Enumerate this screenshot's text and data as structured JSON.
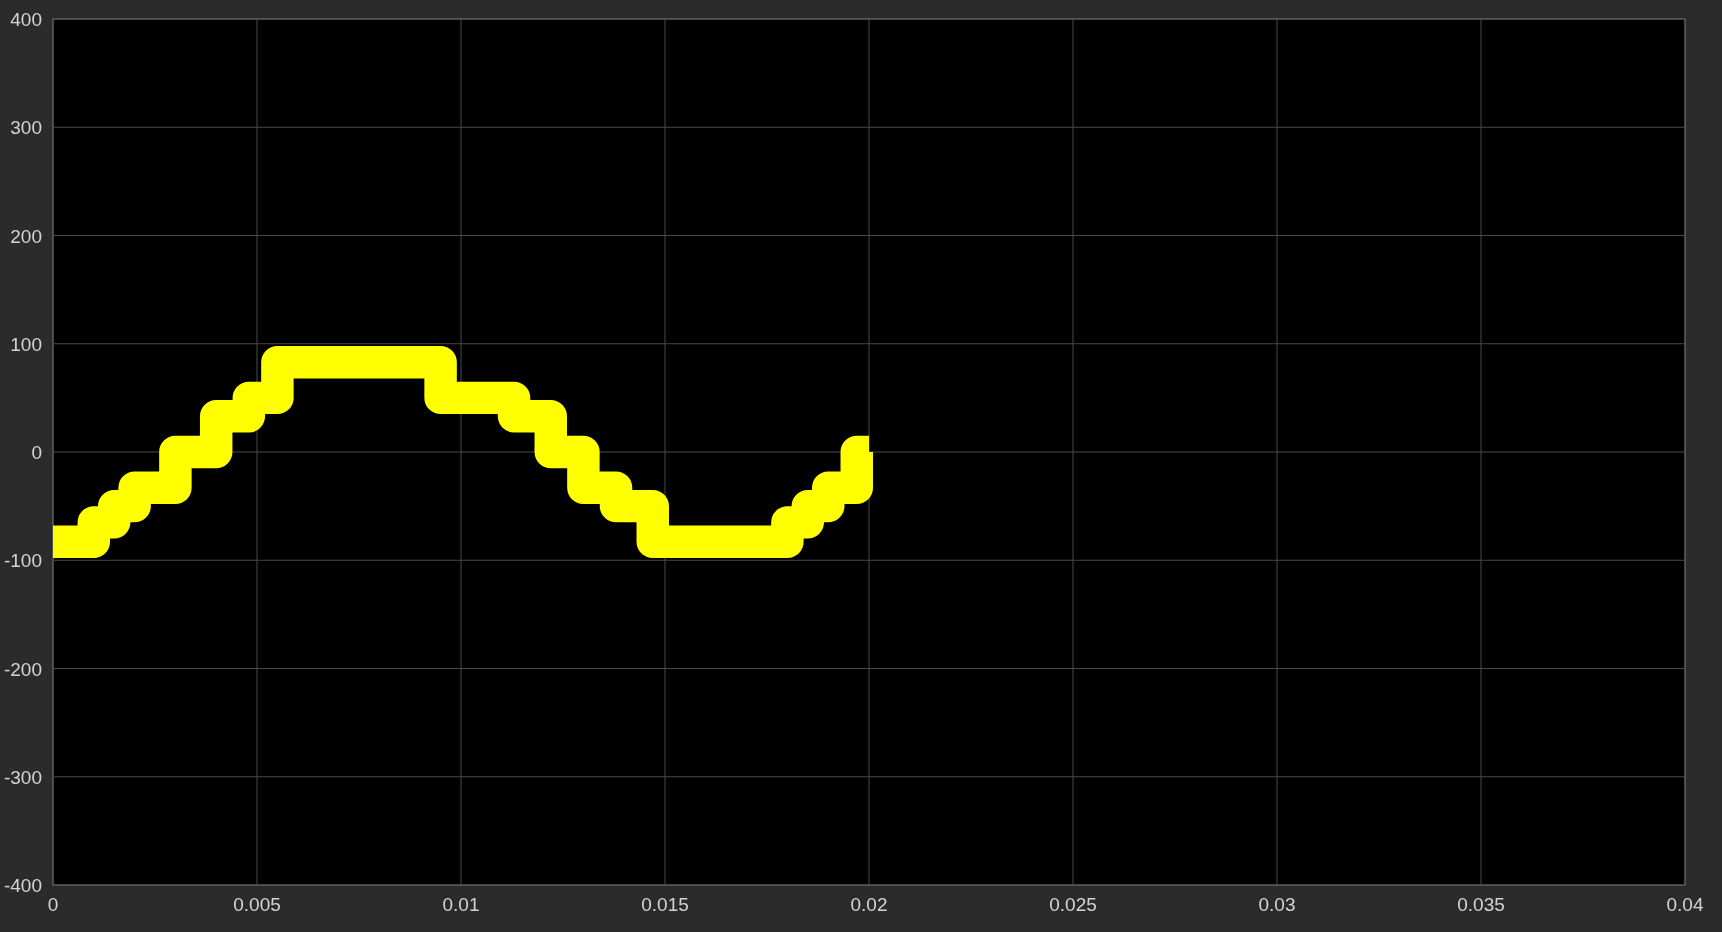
{
  "scope": {
    "chart_data": {
      "type": "line",
      "x": [
        0,
        0.001,
        0.001,
        0.0015,
        0.0015,
        0.002,
        0.002,
        0.003,
        0.003,
        0.004,
        0.004,
        0.0048,
        0.0048,
        0.0055,
        0.0055,
        0.0095,
        0.0095,
        0.0113,
        0.0113,
        0.0122,
        0.0122,
        0.013,
        0.013,
        0.0138,
        0.0138,
        0.0147,
        0.0147,
        0.018,
        0.018,
        0.0185,
        0.0185,
        0.019,
        0.019,
        0.0197,
        0.0197,
        0.02
      ],
      "series": [
        {
          "color": "#ffff00",
          "values": [
            -83,
            -83,
            -65,
            -65,
            -50,
            -50,
            -33,
            -33,
            0,
            0,
            33,
            33,
            50,
            50,
            83,
            83,
            50,
            50,
            33,
            33,
            0,
            0,
            -33,
            -33,
            -50,
            -50,
            -83,
            -83,
            -65,
            -65,
            -50,
            -50,
            -33,
            -33,
            0,
            0
          ]
        }
      ],
      "xlim": [
        0,
        0.04
      ],
      "ylim": [
        -400,
        400
      ],
      "grid": true,
      "xticks": [
        0,
        0.005,
        0.01,
        0.015,
        0.02,
        0.025,
        0.03,
        0.035,
        0.04
      ],
      "yticks": [
        -400,
        -300,
        -200,
        -100,
        0,
        100,
        200,
        300,
        400
      ]
    }
  }
}
